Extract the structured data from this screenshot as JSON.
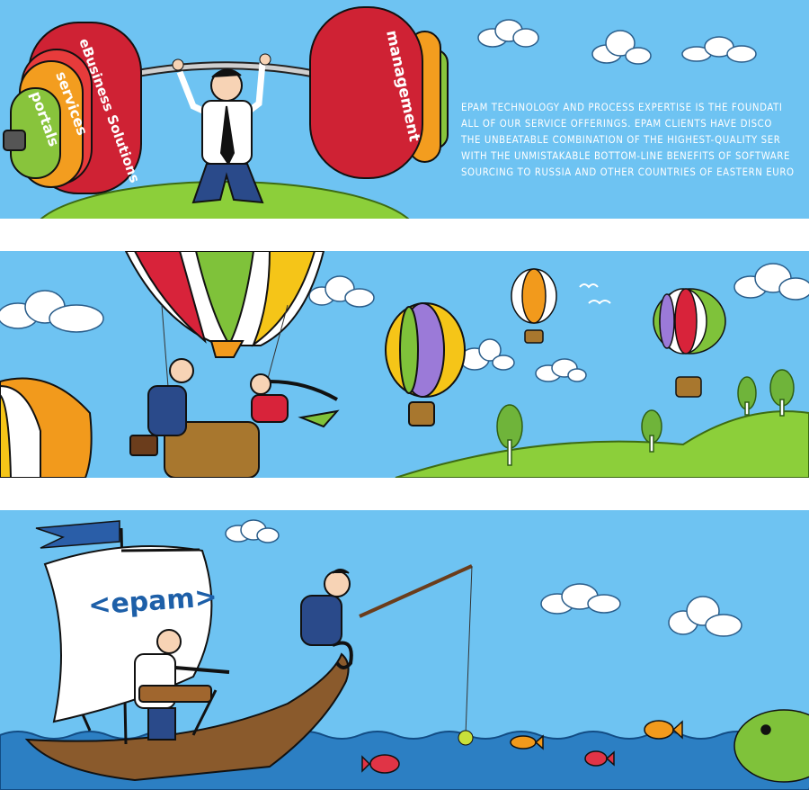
{
  "colors": {
    "sky": "#6ec3f2",
    "white_band": "#ffffff",
    "grass": "#8ccf3a",
    "sea": "#2c7fc3",
    "boat_wood": "#8a5a2c"
  },
  "panel1": {
    "plates": [
      "management",
      "eBusiness Solutions",
      "services",
      "portals"
    ],
    "tagline_lines": [
      "EPAM TECHNOLOGY AND PROCESS EXPERTISE IS THE FOUNDATI",
      "ALL OF OUR SERVICE OFFERINGS. EPAM CLIENTS HAVE DISCO",
      "THE UNBEATABLE COMBINATION OF THE HIGHEST-QUALITY SER",
      "WITH THE UNMISTAKABLE BOTTOM-LINE BENEFITS OF SOFTWARE",
      "SOURCING TO RUSSIA AND OTHER COUNTRIES OF EASTERN EURO"
    ]
  },
  "panel3": {
    "sail_logo": "<epam>"
  }
}
